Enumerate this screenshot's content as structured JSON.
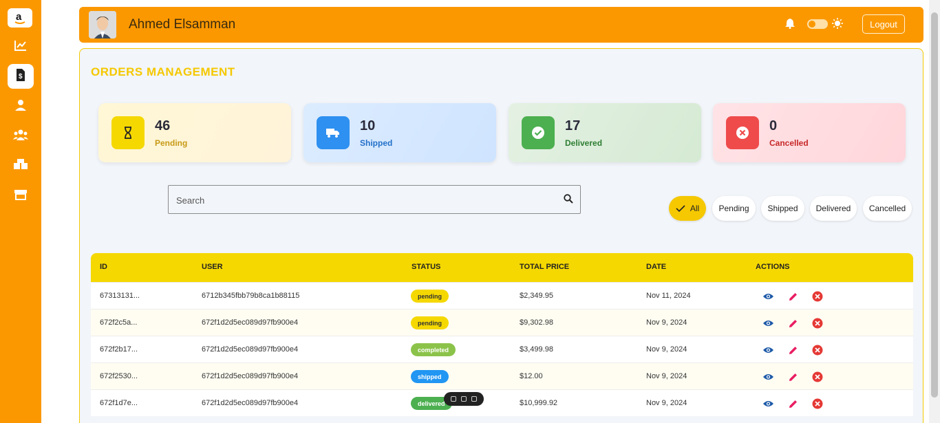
{
  "header": {
    "user_name": "Ahmed Elsamman",
    "logout_label": "Logout"
  },
  "page": {
    "title": "ORDERS MANAGEMENT"
  },
  "stats": [
    {
      "value": "46",
      "label": "Pending",
      "icon": "hourglass-icon"
    },
    {
      "value": "10",
      "label": "Shipped",
      "icon": "truck-icon"
    },
    {
      "value": "17",
      "label": "Delivered",
      "icon": "check-circle-icon"
    },
    {
      "value": "0",
      "label": "Cancelled",
      "icon": "cancel-circle-icon"
    }
  ],
  "search": {
    "placeholder": "Search"
  },
  "filters": [
    "All",
    "Pending",
    "Shipped",
    "Delivered",
    "Cancelled"
  ],
  "table": {
    "headers": [
      "ID",
      "USER",
      "STATUS",
      "TOTAL PRICE",
      "DATE",
      "ACTIONS"
    ],
    "rows": [
      {
        "id": "67313131...",
        "user": "6712b345fbb79b8ca1b88115",
        "status": "pending",
        "price": "$2,349.95",
        "date": "Nov 11, 2024"
      },
      {
        "id": "672f2c5a...",
        "user": "672f1d2d5ec089d97fb900e4",
        "status": "pending",
        "price": "$9,302.98",
        "date": "Nov 9, 2024"
      },
      {
        "id": "672f2b17...",
        "user": "672f1d2d5ec089d97fb900e4",
        "status": "completed",
        "price": "$3,499.98",
        "date": "Nov 9, 2024"
      },
      {
        "id": "672f2530...",
        "user": "672f1d2d5ec089d97fb900e4",
        "status": "shipped",
        "price": "$12.00",
        "date": "Nov 9, 2024"
      },
      {
        "id": "672f1d7e...",
        "user": "672f1d2d5ec089d97fb900e4",
        "status": "delivered",
        "price": "$10,999.92",
        "date": "Nov 9, 2024"
      }
    ]
  },
  "colors": {
    "sidebar": "#fb9800",
    "accent": "#f5c800",
    "pending": "#f5d800",
    "completed": "#8bc34a",
    "shipped": "#2196f3",
    "delivered": "#4caf50",
    "cancel": "#e53935",
    "view": "#1e5aa8",
    "edit": "#e91e63"
  },
  "sidebar_icons": [
    "amazon-logo-icon",
    "chart-line-icon",
    "invoice-icon",
    "user-icon",
    "users-icon",
    "boxes-icon",
    "store-icon"
  ]
}
